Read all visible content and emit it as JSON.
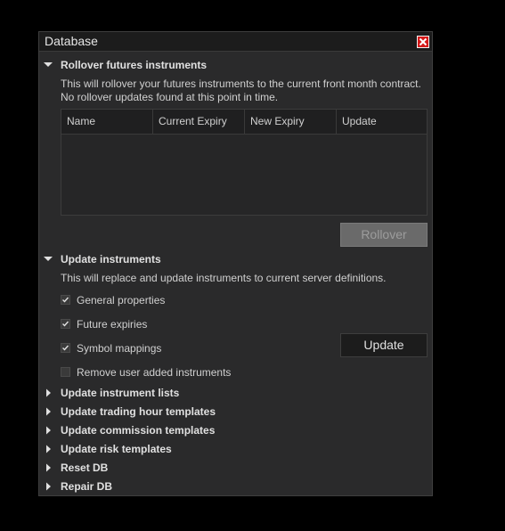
{
  "dialog": {
    "title": "Database"
  },
  "rollover_section": {
    "header": "Rollover futures instruments",
    "desc1": "This will rollover your futures instruments to the current front month contract.",
    "desc2": "No rollover updates found at this point in time.",
    "columns": [
      "Name",
      "Current Expiry",
      "New Expiry",
      "Update"
    ],
    "rollover_label": "Rollover"
  },
  "update_section": {
    "header": "Update instruments",
    "desc": "This will replace and update instruments to current server definitions.",
    "options": [
      {
        "label": "General properties",
        "checked": true
      },
      {
        "label": "Future expiries",
        "checked": true
      },
      {
        "label": "Symbol mappings",
        "checked": true
      },
      {
        "label": "Remove user added instruments",
        "checked": false
      }
    ],
    "update_label": "Update"
  },
  "collapsed_sections": [
    "Update instrument lists",
    "Update trading hour templates",
    "Update commission templates",
    "Update risk templates",
    "Reset DB",
    "Repair DB"
  ],
  "colors": {
    "background": "#000000",
    "dialog": "#2a2a2b",
    "titlebar": "#1c1c1c",
    "close": "#d41919"
  }
}
